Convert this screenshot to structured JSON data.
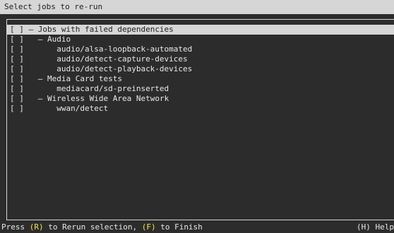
{
  "title": "Select jobs to re-run",
  "jobs": [
    {
      "checkbox": "[ ]",
      "indent": " – ",
      "label": "Jobs with failed dependencies"
    },
    {
      "checkbox": "[ ]",
      "indent": "   – ",
      "label": "Audio"
    },
    {
      "checkbox": "[ ]",
      "indent": "       ",
      "label": "audio/alsa-loopback-automated"
    },
    {
      "checkbox": "[ ]",
      "indent": "       ",
      "label": "audio/detect-capture-devices"
    },
    {
      "checkbox": "[ ]",
      "indent": "       ",
      "label": "audio/detect-playback-devices"
    },
    {
      "checkbox": "[ ]",
      "indent": "   – ",
      "label": "Media Card tests"
    },
    {
      "checkbox": "[ ]",
      "indent": "       ",
      "label": "mediacard/sd-preinserted"
    },
    {
      "checkbox": "[ ]",
      "indent": "   – ",
      "label": "Wireless Wide Area Network"
    },
    {
      "checkbox": "[ ]",
      "indent": "       ",
      "label": "wwan/detect"
    }
  ],
  "status": {
    "press": "Press ",
    "rerun_key": "(R)",
    "rerun_text": " to Rerun selection, ",
    "finish_key": "(F)",
    "finish_text": " to Finish",
    "help": "(H) Help"
  },
  "colors": {
    "background": "#2c2c2c",
    "highlight": "#d6d6d6",
    "key": "#f2e34a"
  }
}
